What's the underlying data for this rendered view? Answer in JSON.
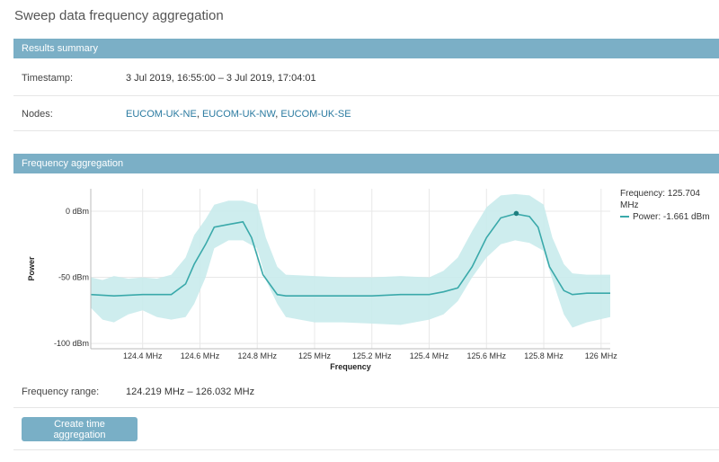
{
  "page": {
    "title": "Sweep data frequency aggregation"
  },
  "summary": {
    "header": "Results summary",
    "timestamp_label": "Timestamp:",
    "timestamp_value": "3 Jul 2019, 16:55:00 – 3 Jul 2019, 17:04:01",
    "nodes_label": "Nodes:",
    "nodes": [
      "EUCOM-UK-NE",
      "EUCOM-UK-NW",
      "EUCOM-UK-SE"
    ],
    "nodes_separator": ", "
  },
  "aggregation": {
    "header": "Frequency aggregation",
    "tooltip": {
      "frequency": "Frequency: 125.704 MHz",
      "power": "Power: -1.661 dBm"
    },
    "range_label": "Frequency range:",
    "range_value": "124.219 MHz – 126.032 MHz",
    "button_label": "Create time aggregation"
  },
  "colors": {
    "header": "#7bafc6",
    "line": "#3aa9aa",
    "band": "#c9ebec",
    "link": "#2a7aa0"
  },
  "chart_data": {
    "type": "area",
    "xlabel": "Frequency",
    "ylabel": "Power",
    "xlim": [
      124.219,
      126.032
    ],
    "ylim": [
      -104,
      17
    ],
    "x_ticks": [
      124.4,
      124.6,
      124.8,
      125.0,
      125.2,
      125.4,
      125.6,
      125.8,
      126.0
    ],
    "x_tick_labels": [
      "124.4 MHz",
      "124.6 MHz",
      "124.8 MHz",
      "125 MHz",
      "125.2 MHz",
      "125.4 MHz",
      "125.6 MHz",
      "125.8 MHz",
      "126 MHz"
    ],
    "y_ticks": [
      0,
      -50,
      -100
    ],
    "y_tick_labels": [
      "0 dBm",
      "-50 dBm",
      "-100 dBm"
    ],
    "grid": true,
    "series": [
      {
        "kind": "range",
        "x": [
          124.219,
          124.26,
          124.3,
          124.35,
          124.4,
          124.45,
          124.5,
          124.55,
          124.58,
          124.62,
          124.65,
          124.7,
          124.75,
          124.8,
          124.83,
          124.87,
          124.9,
          125.0,
          125.1,
          125.2,
          125.3,
          125.4,
          125.45,
          125.5,
          125.55,
          125.6,
          125.65,
          125.7,
          125.75,
          125.8,
          125.83,
          125.87,
          125.9,
          125.95,
          126.032
        ],
        "high": [
          -50,
          -52,
          -49,
          -51,
          -50,
          -51,
          -48,
          -35,
          -18,
          -6,
          5,
          8,
          8,
          5,
          -20,
          -42,
          -48,
          -49,
          -50,
          -50,
          -49,
          -50,
          -45,
          -35,
          -15,
          3,
          12,
          13,
          12,
          5,
          -20,
          -40,
          -47,
          -48,
          -48
        ],
        "low": [
          -73,
          -82,
          -84,
          -78,
          -75,
          -80,
          -82,
          -80,
          -70,
          -50,
          -28,
          -22,
          -22,
          -28,
          -52,
          -70,
          -80,
          -84,
          -84,
          -85,
          -86,
          -82,
          -78,
          -68,
          -50,
          -35,
          -25,
          -22,
          -24,
          -30,
          -52,
          -78,
          -88,
          -84,
          -80
        ]
      },
      {
        "kind": "line",
        "x": [
          124.219,
          124.3,
          124.4,
          124.5,
          124.55,
          124.58,
          124.62,
          124.65,
          124.7,
          124.75,
          124.78,
          124.82,
          124.87,
          124.9,
          125.0,
          125.1,
          125.2,
          125.3,
          125.4,
          125.45,
          125.5,
          125.55,
          125.6,
          125.65,
          125.7,
          125.75,
          125.78,
          125.82,
          125.87,
          125.9,
          125.95,
          126.032
        ],
        "y": [
          -63,
          -64,
          -63,
          -63,
          -55,
          -40,
          -25,
          -12,
          -10,
          -8,
          -20,
          -48,
          -63,
          -64,
          -64,
          -64,
          -64,
          -63,
          -63,
          -61,
          -58,
          -42,
          -20,
          -5,
          -2,
          -4,
          -12,
          -42,
          -60,
          -63,
          -62,
          -62
        ]
      }
    ],
    "highlight": {
      "x": 125.704,
      "y": -1.661
    }
  }
}
